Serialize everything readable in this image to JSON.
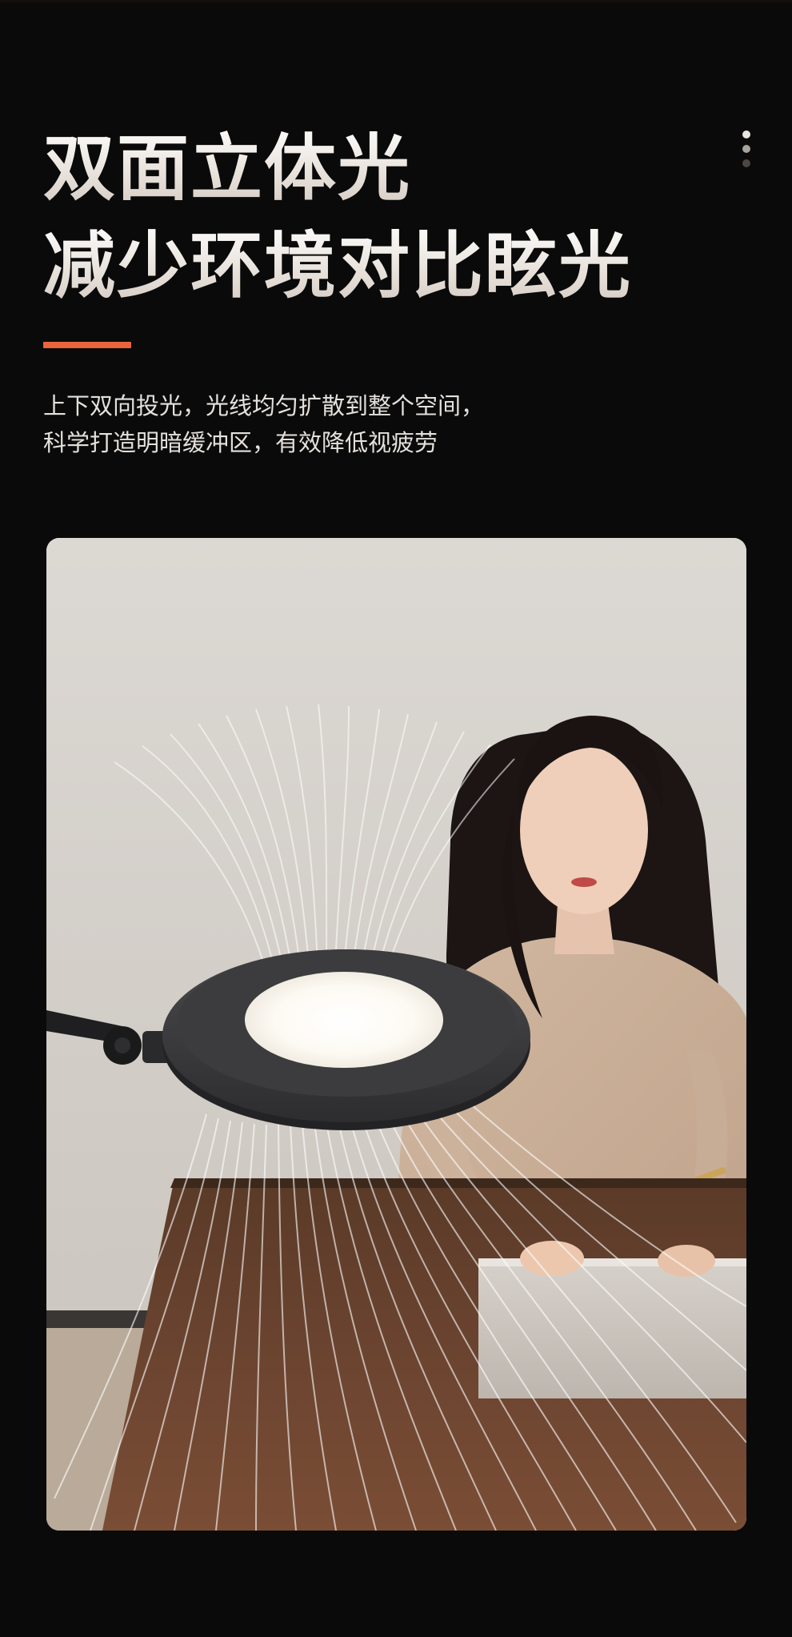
{
  "headline": {
    "line1": "双面立体光",
    "line2": "减少环境对比眩光"
  },
  "description": {
    "line1": "上下双向投光，光线均匀扩散到整个空间，",
    "line2": "科学打造明暗缓冲区，有效降低视疲劳"
  },
  "colors": {
    "background": "#0a0a0a",
    "accent": "#e9653d",
    "text": "#f2eee9"
  },
  "icons": {
    "menu": "vertical-dots-icon"
  }
}
